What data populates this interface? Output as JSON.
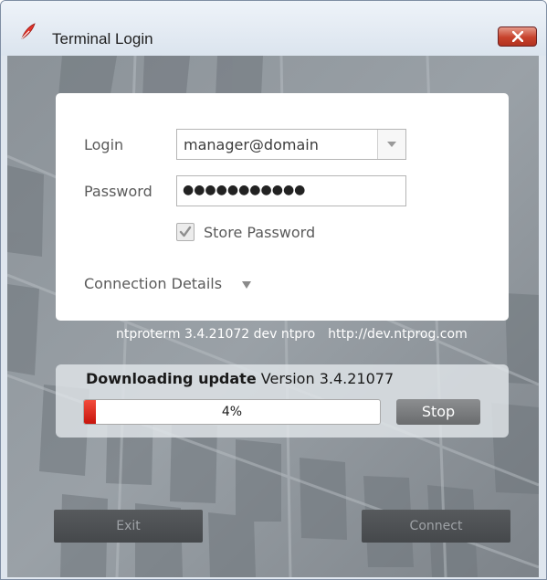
{
  "window": {
    "title": "Terminal Login",
    "app_icon": "red-feather-icon",
    "close_icon": "close-icon"
  },
  "login": {
    "login_label": "Login",
    "login_value": "manager@domain",
    "password_label": "Password",
    "password_value": "●●●●●●●●●●●",
    "store_password_label": "Store Password",
    "store_password_checked": true,
    "connection_details_label": "Connection Details",
    "connection_details_icon": "triangle-down-icon"
  },
  "version": {
    "build": "ntproterm 3.4.21072 dev ntpro",
    "url": "http://dev.ntprog.com"
  },
  "update": {
    "status": "Downloading update",
    "version": "Version 3.4.21077",
    "progress_percent": 4,
    "progress_text": "4%",
    "stop_label": "Stop"
  },
  "buttons": {
    "exit_label": "Exit",
    "connect_label": "Connect"
  },
  "colors": {
    "progress_fill": "#e0251a",
    "close_button": "#c7422c",
    "panel_white": "#ffffff",
    "dark_button": "#4f5255"
  }
}
